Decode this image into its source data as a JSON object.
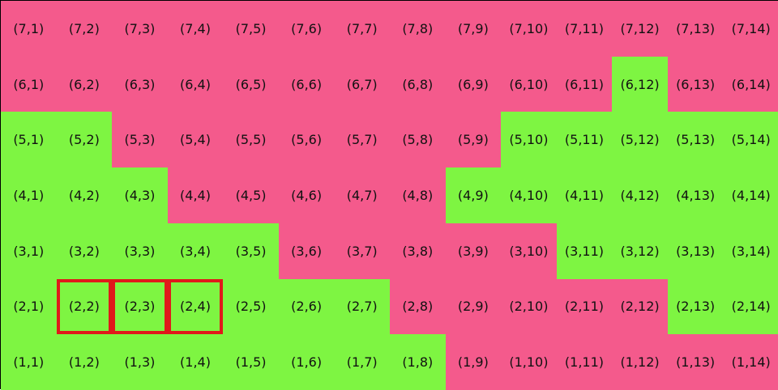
{
  "colors": {
    "green": "#7ef542",
    "pink": "#f45a8c",
    "selection": "#e0191a"
  },
  "grid": {
    "rows": 7,
    "cols": 14,
    "cells": [
      [
        "(7,1)",
        "(7,2)",
        "(7,3)",
        "(7,4)",
        "(7,5)",
        "(7,6)",
        "(7,7)",
        "(7,8)",
        "(7,9)",
        "(7,10)",
        "(7,11)",
        "(7,12)",
        "(7,13)",
        "(7,14)"
      ],
      [
        "(6,1)",
        "(6,2)",
        "(6,3)",
        "(6,4)",
        "(6,5)",
        "(6,6)",
        "(6,7)",
        "(6,8)",
        "(6,9)",
        "(6,10)",
        "(6,11)",
        "(6,12)",
        "(6,13)",
        "(6,14)"
      ],
      [
        "(5,1)",
        "(5,2)",
        "(5,3)",
        "(5,4)",
        "(5,5)",
        "(5,6)",
        "(5,7)",
        "(5,8)",
        "(5,9)",
        "(5,10)",
        "(5,11)",
        "(5,12)",
        "(5,13)",
        "(5,14)"
      ],
      [
        "(4,1)",
        "(4,2)",
        "(4,3)",
        "(4,4)",
        "(4,5)",
        "(4,6)",
        "(4,7)",
        "(4,8)",
        "(4,9)",
        "(4,10)",
        "(4,11)",
        "(4,12)",
        "(4,13)",
        "(4,14)"
      ],
      [
        "(3,1)",
        "(3,2)",
        "(3,3)",
        "(3,4)",
        "(3,5)",
        "(3,6)",
        "(3,7)",
        "(3,8)",
        "(3,9)",
        "(3,10)",
        "(3,11)",
        "(3,12)",
        "(3,13)",
        "(3,14)"
      ],
      [
        "(2,1)",
        "(2,2)",
        "(2,3)",
        "(2,4)",
        "(2,5)",
        "(2,6)",
        "(2,7)",
        "(2,8)",
        "(2,9)",
        "(2,10)",
        "(2,11)",
        "(2,12)",
        "(2,13)",
        "(2,14)"
      ],
      [
        "(1,1)",
        "(1,2)",
        "(1,3)",
        "(1,4)",
        "(1,5)",
        "(1,6)",
        "(1,7)",
        "(1,8)",
        "(1,9)",
        "(1,10)",
        "(1,11)",
        "(1,12)",
        "(1,13)",
        "(1,14)"
      ]
    ],
    "colors": [
      [
        "P",
        "P",
        "P",
        "P",
        "P",
        "P",
        "P",
        "P",
        "P",
        "P",
        "P",
        "P",
        "P",
        "P"
      ],
      [
        "P",
        "P",
        "P",
        "P",
        "P",
        "P",
        "P",
        "P",
        "P",
        "P",
        "P",
        "G",
        "P",
        "P"
      ],
      [
        "G",
        "G",
        "P",
        "P",
        "P",
        "P",
        "P",
        "P",
        "P",
        "G",
        "G",
        "G",
        "G",
        "G"
      ],
      [
        "G",
        "G",
        "G",
        "P",
        "P",
        "P",
        "P",
        "P",
        "G",
        "G",
        "G",
        "G",
        "G",
        "G"
      ],
      [
        "G",
        "G",
        "G",
        "G",
        "G",
        "P",
        "P",
        "P",
        "P",
        "P",
        "G",
        "G",
        "G",
        "G"
      ],
      [
        "G",
        "G",
        "G",
        "G",
        "G",
        "G",
        "G",
        "P",
        "P",
        "P",
        "P",
        "P",
        "G",
        "G"
      ],
      [
        "G",
        "G",
        "G",
        "G",
        "G",
        "G",
        "G",
        "G",
        "P",
        "P",
        "P",
        "P",
        "P",
        "P"
      ]
    ],
    "selected": [
      "(2,2)",
      "(2,3)",
      "(2,4)"
    ]
  }
}
